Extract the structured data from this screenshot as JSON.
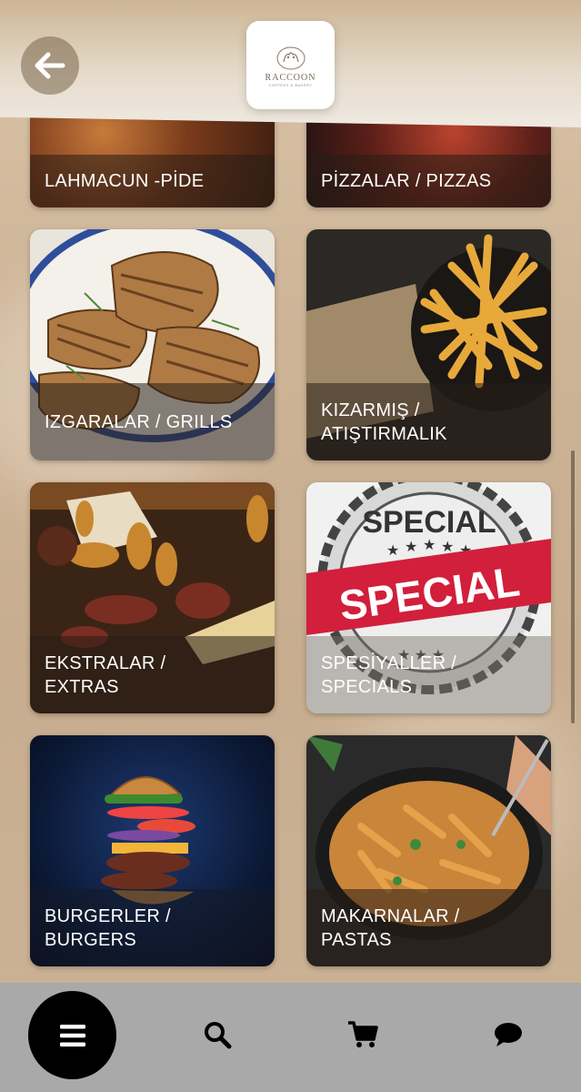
{
  "brand": {
    "name": "RACCOON",
    "tagline": "COFFEES & BAKERY"
  },
  "icons": {
    "back": "arrow-left-icon",
    "menu": "hamburger-menu-icon",
    "search": "search-icon",
    "cart": "cart-icon",
    "chat": "chat-bubble-icon"
  },
  "categories": [
    {
      "label": "LAHMACUN -PİDE"
    },
    {
      "label": "PİZZALAR / PIZZAS"
    },
    {
      "label": "IZGARALAR / GRILLS"
    },
    {
      "label": "KIZARMIŞ / ATIŞTIRMALIK"
    },
    {
      "label": "EKSTRALAR / EXTRAS"
    },
    {
      "label": "SPESİYALLER / SPECIALS"
    },
    {
      "label": "BURGERLER / BURGERS"
    },
    {
      "label": "MAKARNALAR / PASTAS"
    }
  ],
  "special_badge": {
    "arc_text": "SPECIAL",
    "banner_text": "SPECIAL"
  },
  "colors": {
    "bottom_bar": "#a9a9a9",
    "fab": "#000000",
    "special_red": "#d21f3c"
  }
}
